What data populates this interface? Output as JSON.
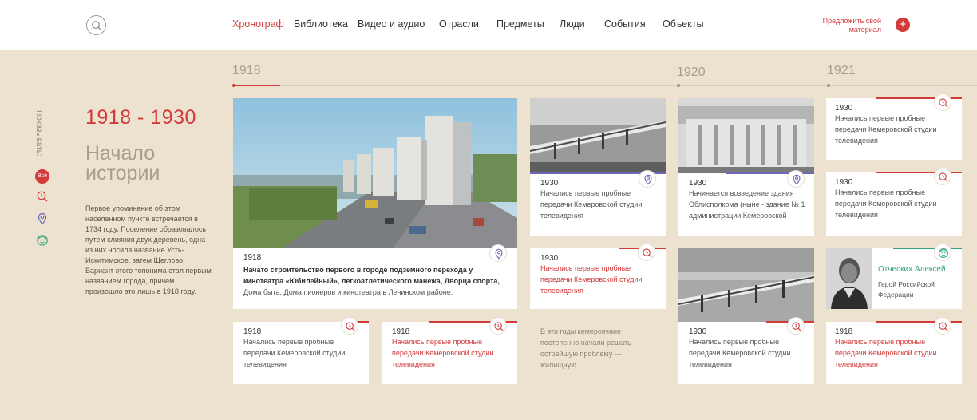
{
  "nav": {
    "items": [
      "Хронограф",
      "Библиотека",
      "Видео и аудио",
      "Отрасли",
      "Предметы",
      "Люди",
      "События",
      "Объекты"
    ],
    "suggest": "Предложить свой материал"
  },
  "timeline": {
    "years": [
      "1918",
      "1920",
      "1921"
    ]
  },
  "sidebar": {
    "show_label": "Показывать:",
    "all_label": "Всё"
  },
  "intro": {
    "period": "1918 - 1930",
    "title": "Начало истории",
    "text": "Первое упоминание об этом населенном пункте встречается в 1734 году. Поселение образовалось путем слияния двух деревень, одна из них носила название Усть-Искитимское, затем Щеглово. Вариант этого топонима стал первым названием города, причем произошло это лишь в 1918 году."
  },
  "cards": {
    "main": {
      "year": "1918",
      "text_bold": "Начато строительство первого в городе подземного перехода у кинотеатра «Юбилейный», легкоатлетического манежа, Дворца спорта,",
      "text_rest": "Дома быта, Дома пионеров и кинотеатра в Ленинском районе."
    },
    "c1": {
      "year": "1918",
      "text": "Начались первые пробные передачи Кемеровской студии телевидения"
    },
    "c2": {
      "year": "1918",
      "text": "Начались первые пробные передачи Кемеровской студии телевидения"
    },
    "c3": {
      "year": "1930",
      "text": "Начались первые пробные передачи Кемеровской студии телевидения"
    },
    "c4": {
      "year": "1930",
      "text": "Начались первые пробные передачи Кемеровской студии телевидения"
    },
    "c5": {
      "text": "В эти годы кемеровчане постепенно начали решать острейшую проблему — жилищную"
    },
    "c6": {
      "year": "1930",
      "text": "Начинается возведение здания Облисполкома (ныне - здание № 1 администрации Кемеровской"
    },
    "c7": {
      "year": "1930",
      "text": "Начались первые пробные передачи Кемеровской студии телевидения"
    },
    "c8": {
      "year": "1930",
      "text": "Начались первые пробные передачи Кемеровской студии телевидения"
    },
    "c9": {
      "year": "1930",
      "text": "Начались первые пробные передачи Кемеровской студии телевидения"
    },
    "person": {
      "name": "Отческих Алексей",
      "role": "Герой Российской Федерации"
    },
    "c10": {
      "year": "1918",
      "text": "Начались первые пробные передачи Кемеровской студии телевидения"
    }
  },
  "colors": {
    "accent": "#d33a3a",
    "place": "#6a6ab8",
    "person": "#3aa37a",
    "background": "#ece2cf"
  }
}
